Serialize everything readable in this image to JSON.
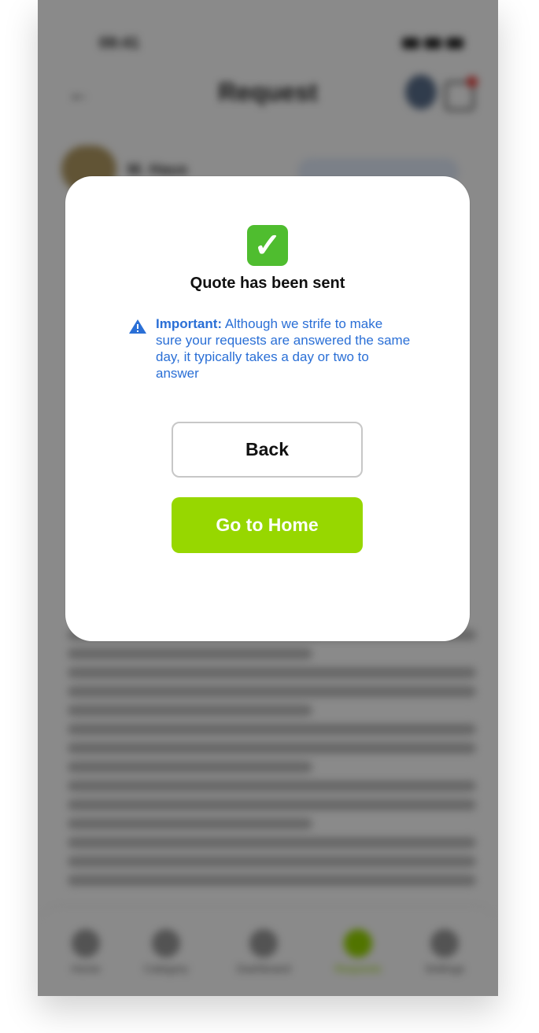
{
  "background_screen": {
    "status_bar": {
      "time": "09:41"
    },
    "header": {
      "title": "Request"
    },
    "provider": {
      "name": "M. Haus"
    },
    "tab_bar": {
      "items": [
        {
          "label": "Home",
          "active": false
        },
        {
          "label": "Category",
          "active": false
        },
        {
          "label": "Dashboard",
          "active": false
        },
        {
          "label": "Requests",
          "active": true
        },
        {
          "label": "Settings",
          "active": false
        }
      ]
    }
  },
  "modal": {
    "icon": "check-mark-icon",
    "title": "Quote has been sent",
    "notice": {
      "icon": "warning-icon",
      "label": "Important:",
      "text": "Although we strife to make sure your requests are answered the same day, it typically takes a day or two to answer"
    },
    "back_button": "Back",
    "home_button": "Go to Home"
  },
  "colors": {
    "accent_green": "#97d700",
    "notice_blue": "#2a6fd6",
    "check_green": "#4fbd2f"
  }
}
